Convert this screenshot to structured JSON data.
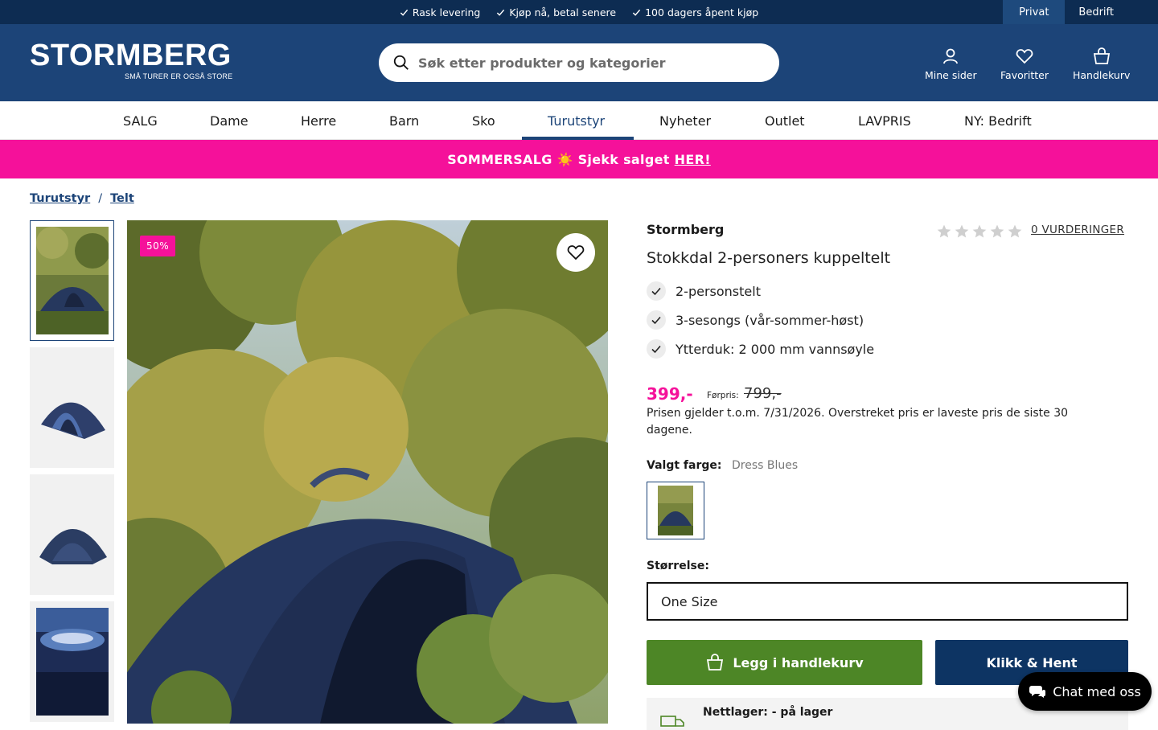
{
  "topbar": {
    "usps": [
      "Rask levering",
      "Kjøp nå, betal senere",
      "100 dagers åpent kjøp"
    ],
    "segments": [
      "Privat",
      "Bedrift"
    ]
  },
  "header": {
    "logo_text": "STORMBERG",
    "logo_tagline": "SMÅ TURER ER OGSÅ STORE",
    "search_placeholder": "Søk etter produkter og kategorier",
    "icons": {
      "account": "Mine sider",
      "favorites": "Favoritter",
      "cart": "Handlekurv"
    }
  },
  "nav": {
    "items": [
      "SALG",
      "Dame",
      "Herre",
      "Barn",
      "Sko",
      "Turutstyr",
      "Nyheter",
      "Outlet",
      "LAVPRIS",
      "NY: Bedrift"
    ],
    "active": "Turutstyr"
  },
  "promo": {
    "text": "SOMMERSALG ☀️ Sjekk salget",
    "link": "HER! "
  },
  "breadcrumb": [
    "Turutstyr",
    "Telt"
  ],
  "product": {
    "discount_badge": "50%",
    "brand": "Stormberg",
    "rating_count_label": "0 VURDERINGER",
    "rating": 0,
    "title": "Stokkdal 2-personers kuppeltelt",
    "features": [
      "2-personstelt",
      "3-sesongs (vår-sommer-høst)",
      "Ytterduk: 2 000 mm vannsøyle"
    ],
    "price": "399,-",
    "before_label": "Førpris:",
    "before_price": "799,-",
    "price_note": "Prisen gjelder t.o.m. 7/31/2026. Overstreket pris er laveste pris de siste 30 dagene.",
    "color_label": "Valgt farge:",
    "color_value": "Dress Blues",
    "size_label": "Størrelse:",
    "size_value": "One Size",
    "add_to_cart": "Legg i handlekurv",
    "click_collect": "Klikk & Hent",
    "stock": "Nettlager: - på lager"
  },
  "chat": {
    "label": "Chat med oss"
  },
  "colors": {
    "navy": "#1c4478",
    "dark_navy": "#0d2c52",
    "pink": "#f5119a",
    "green": "#4d8626"
  }
}
